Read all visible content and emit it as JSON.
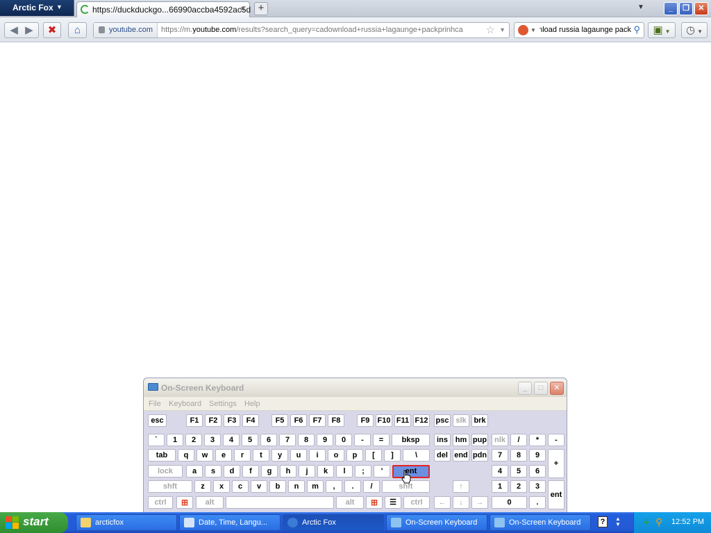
{
  "browser": {
    "app_menu_label": "Arctic Fox",
    "tab_title": "https://duckduckgo...66990accba4592ac5d",
    "tab_close": "×",
    "new_tab": "+",
    "identity_label": "youtube.com",
    "url_prefix": "https://m.",
    "url_host": "youtube.com",
    "url_path": "/results?search_query=cadownload+russia+lagaunge+packprinhca",
    "search_value": "download russia lagaunge pack"
  },
  "osk": {
    "title": "On-Screen Keyboard",
    "menu": [
      "File",
      "Keyboard",
      "Settings",
      "Help"
    ],
    "rows": {
      "r1": [
        "esc",
        "F1",
        "F2",
        "F3",
        "F4",
        "F5",
        "F6",
        "F7",
        "F8",
        "F9",
        "F10",
        "F11",
        "F12",
        "psc",
        "slk",
        "brk"
      ],
      "r2": [
        "`",
        "1",
        "2",
        "3",
        "4",
        "5",
        "6",
        "7",
        "8",
        "9",
        "0",
        "-",
        "=",
        "bksp",
        "ins",
        "hm",
        "pup",
        "nlk",
        "/",
        "*",
        "-"
      ],
      "r3": [
        "tab",
        "q",
        "w",
        "e",
        "r",
        "t",
        "y",
        "u",
        "i",
        "o",
        "p",
        "[",
        "]",
        "\\",
        "del",
        "end",
        "pdn",
        "7",
        "8",
        "9",
        "+"
      ],
      "r4": [
        "lock",
        "a",
        "s",
        "d",
        "f",
        "g",
        "h",
        "j",
        "k",
        "l",
        ";",
        "'",
        "ent",
        "4",
        "5",
        "6"
      ],
      "r5": [
        "shft",
        "z",
        "x",
        "c",
        "v",
        "b",
        "n",
        "m",
        ",",
        ".",
        "/",
        "shft",
        "↑",
        "1",
        "2",
        "3",
        "ent"
      ],
      "r6": [
        "ctrl",
        "alt",
        "alt",
        "ctrl",
        "←",
        "↓",
        "→",
        "0",
        "."
      ]
    }
  },
  "taskbar": {
    "start_label": "start",
    "tasks": [
      "arcticfox",
      "Date, Time, Langu...",
      "Arctic Fox",
      "On-Screen Keyboard",
      "On-Screen Keyboard"
    ],
    "clock": "12:52 PM"
  }
}
